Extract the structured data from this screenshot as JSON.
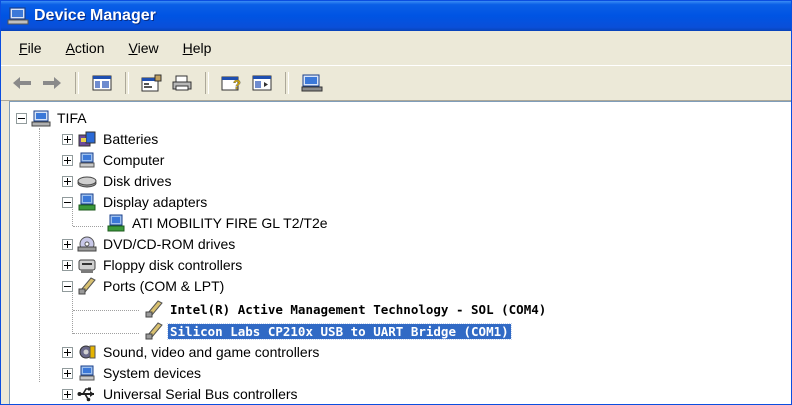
{
  "window": {
    "title": "Device Manager"
  },
  "menu": [
    {
      "accel": "F",
      "rest": "ile"
    },
    {
      "accel": "A",
      "rest": "ction"
    },
    {
      "accel": "V",
      "rest": "iew"
    },
    {
      "accel": "H",
      "rest": "elp"
    }
  ],
  "toolbar": {
    "buttons": [
      "back-arrow-icon",
      "forward-arrow-icon",
      "show-hide-tree-icon",
      "properties-icon",
      "print-icon",
      "help-icon",
      "console-view-icon",
      "scan-hardware-icon"
    ]
  },
  "tree": {
    "root": "TIFA",
    "categories": [
      {
        "label": "Batteries",
        "icon": "battery-icon",
        "expanded": false
      },
      {
        "label": "Computer",
        "icon": "computer-icon",
        "expanded": false
      },
      {
        "label": "Disk drives",
        "icon": "disk-drive-icon",
        "expanded": false
      },
      {
        "label": "Display adapters",
        "icon": "display-adapter-icon",
        "expanded": true,
        "children": [
          {
            "label": "ATI MOBILITY FIRE GL T2/T2e",
            "icon": "display-adapter-icon"
          }
        ]
      },
      {
        "label": "DVD/CD-ROM drives",
        "icon": "dvd-drive-icon",
        "expanded": false
      },
      {
        "label": "Floppy disk controllers",
        "icon": "floppy-controller-icon",
        "expanded": false
      },
      {
        "label": "Ports (COM & LPT)",
        "icon": "port-connector-icon",
        "expanded": true,
        "children": [
          {
            "label": "Intel(R) Active Management Technology - SOL (COM4)",
            "icon": "port-connector-icon"
          },
          {
            "label": "Silicon Labs CP210x USB to UART Bridge (COM1)",
            "icon": "port-connector-icon",
            "selected": true
          }
        ]
      },
      {
        "label": "Sound, video and game controllers",
        "icon": "sound-icon",
        "expanded": false
      },
      {
        "label": "System devices",
        "icon": "system-devices-icon",
        "expanded": false
      },
      {
        "label": "Universal Serial Bus controllers",
        "icon": "usb-icon",
        "expanded": false
      }
    ]
  },
  "colors": {
    "titlebar": "#0054e3",
    "selection": "#316ac5",
    "chrome": "#ece9d8"
  }
}
